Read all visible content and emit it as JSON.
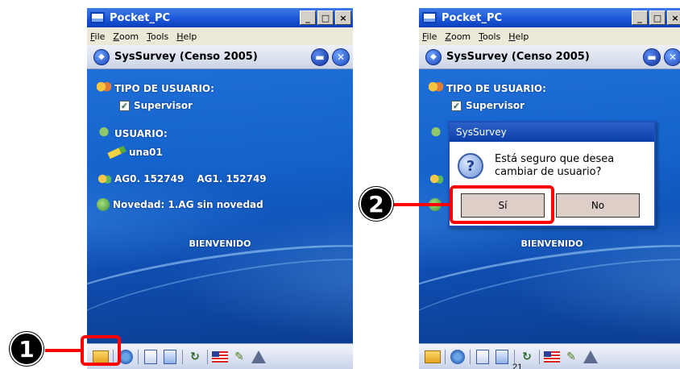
{
  "window": {
    "title": "Pocket_PC",
    "buttons": [
      "_",
      "□",
      "×"
    ],
    "menu": [
      "File",
      "Zoom",
      "Tools",
      "Help"
    ]
  },
  "app": {
    "header_title": "SysSurvey  (Censo 2005)",
    "user_type_label": "TIPO DE USUARIO:",
    "user_type_value": "Supervisor",
    "user_label": "USUARIO:",
    "user_value": "una01",
    "ag0": "AG0. 152749",
    "ag1": "AG1. 152749",
    "novelty": "Novedad:  1.AG sin novedad",
    "welcome": "BIENVENIDO"
  },
  "toolbar_icons": [
    "open-folder-icon",
    "network-icon",
    "document-icon",
    "document-export-icon",
    "sync-icon",
    "us-flag-icon",
    "brush-icon",
    "triangle-icon"
  ],
  "dialog": {
    "title": "SysSurvey",
    "message_line1": "Está seguro que desea",
    "message_line2": "cambiar de usuario?",
    "yes": "Sí",
    "no": "No"
  },
  "callouts": {
    "step1": "1",
    "step2": "2",
    "color": "#ff0000"
  },
  "page_number": "21"
}
